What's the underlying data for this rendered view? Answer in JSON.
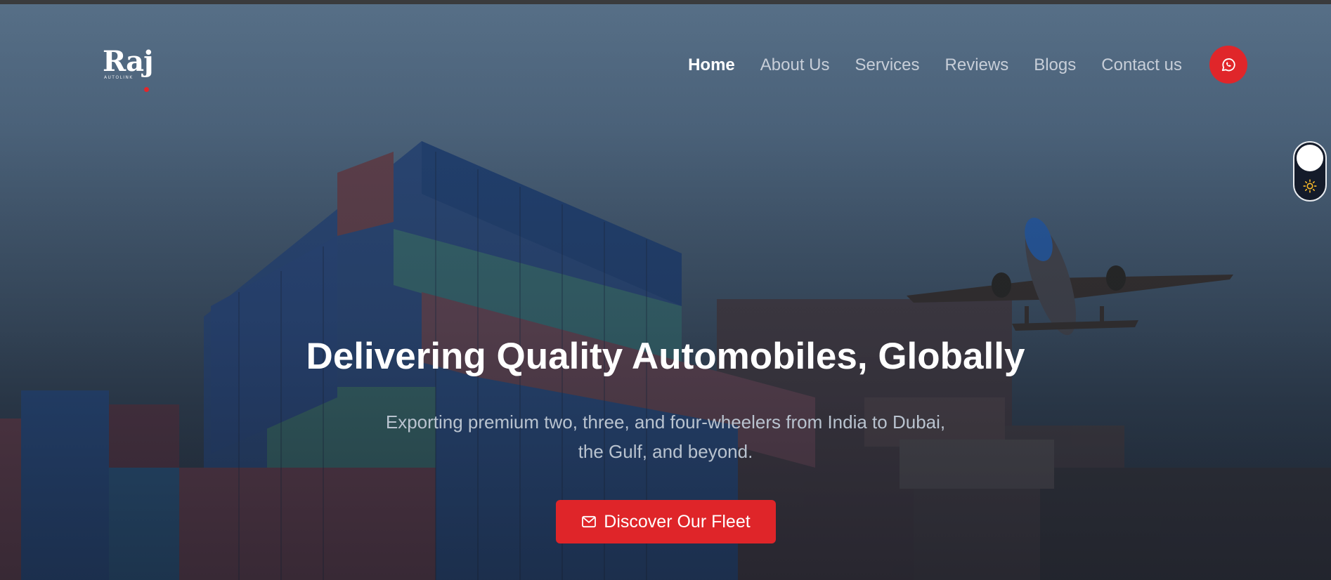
{
  "brand": {
    "logo_text": "Raj",
    "logo_subtext": "AUTOLINK"
  },
  "nav": {
    "items": [
      {
        "label": "Home",
        "active": true
      },
      {
        "label": "About Us",
        "active": false
      },
      {
        "label": "Services",
        "active": false
      },
      {
        "label": "Reviews",
        "active": false
      },
      {
        "label": "Blogs",
        "active": false
      },
      {
        "label": "Contact us",
        "active": false
      }
    ]
  },
  "actions": {
    "whatsapp_icon": "whatsapp-icon",
    "theme_icon": "sun-icon"
  },
  "hero": {
    "headline": "Delivering Quality Automobiles, Globally",
    "subline": "Exporting premium two, three, and four-wheelers from India to Dubai, the Gulf, and beyond.",
    "cta_label": "Discover Our Fleet",
    "cta_icon": "mail-icon"
  },
  "colors": {
    "accent": "#e0262a",
    "text_primary": "#ffffff",
    "text_muted": "#b9c3cf"
  }
}
